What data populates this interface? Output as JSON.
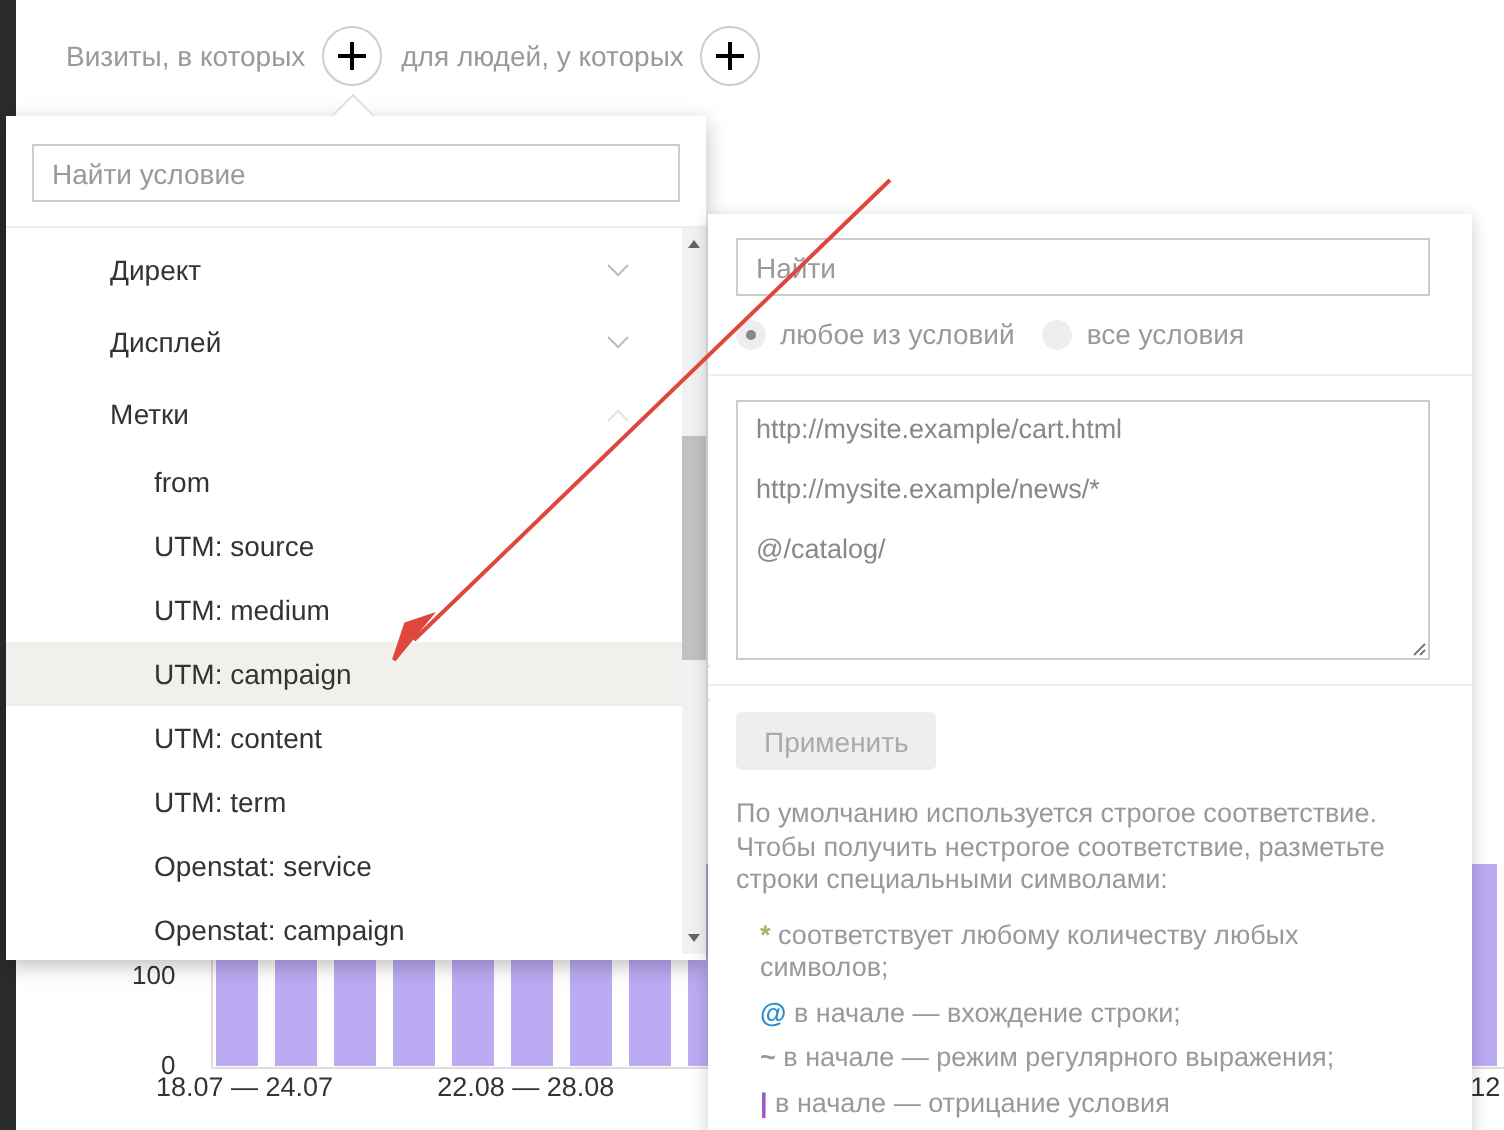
{
  "filter_bar": {
    "visits_label": "Визиты, в которых",
    "people_label": "для людей, у которых"
  },
  "chart_background": {
    "y_labels": [
      "100",
      "0"
    ],
    "x_labels": [
      "18.07 — 24.07",
      "22.08 — 28.08",
      "12"
    ]
  },
  "condition_menu": {
    "search": {
      "placeholder": "Найти условие"
    },
    "groups": [
      {
        "label": "Директ",
        "expanded": false
      },
      {
        "label": "Дисплей",
        "expanded": false
      },
      {
        "label": "Метки",
        "expanded": true,
        "children": [
          {
            "label": "from",
            "selected": false
          },
          {
            "label": "UTM: source",
            "selected": false
          },
          {
            "label": "UTM: medium",
            "selected": false
          },
          {
            "label": "UTM: campaign",
            "selected": true
          },
          {
            "label": "UTM: content",
            "selected": false
          },
          {
            "label": "UTM: term",
            "selected": false
          },
          {
            "label": "Openstat: service",
            "selected": false
          },
          {
            "label": "Openstat: campaign",
            "selected": false
          }
        ]
      }
    ]
  },
  "condition_panel": {
    "search": {
      "placeholder": "Найти"
    },
    "match_mode": [
      {
        "label": "любое из условий",
        "selected": true
      },
      {
        "label": "все условия",
        "selected": false
      }
    ],
    "values": [
      "http://mysite.example/cart.html",
      "http://mysite.example/news/*",
      "@/catalog/"
    ],
    "apply_button": {
      "label": "Применить",
      "disabled": true
    },
    "help": {
      "intro": "По умолчанию используется строгое соответствие. Чтобы получить нестрогое соответствие, разметьте строки специальными символами:",
      "rules": [
        {
          "symbol": "*",
          "color": "#9aba5c",
          "text": "соответствует любому количеству любых символов;"
        },
        {
          "symbol": "@",
          "color": "#2f8fce",
          "text": "в начале — вхождение строки;"
        },
        {
          "symbol": "~",
          "color": "#999999",
          "text": "в начале — режим регулярного выражения;"
        },
        {
          "symbol": "|",
          "color": "#9b59c6",
          "text": "в начале — отрицание условия"
        }
      ]
    }
  }
}
